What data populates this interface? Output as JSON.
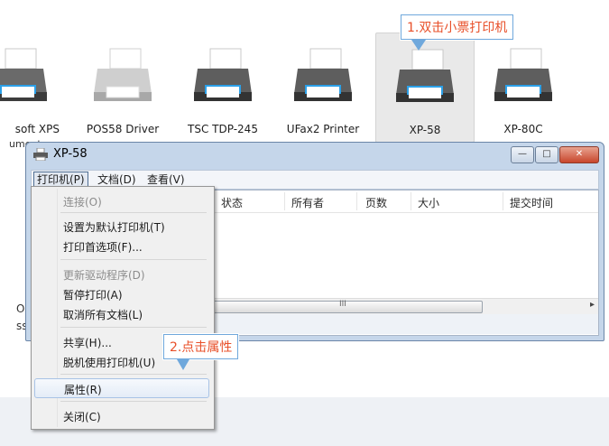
{
  "devices": [
    {
      "label": "soft XPS",
      "selected": false
    },
    {
      "label": "POS58 Driver",
      "selected": false
    },
    {
      "label": "TSC TDP-245",
      "selected": false
    },
    {
      "label": "UFax2 Printer",
      "selected": false
    },
    {
      "label": "XP-58",
      "selected": true
    },
    {
      "label": "XP-80C",
      "selected": false
    }
  ],
  "partial_texts": {
    "line1": "ument",
    "line2": "'ri",
    "left_o": "O",
    "left_ss": "ss"
  },
  "callout1": "1.双击小票打印机",
  "callout2": "2.点击属性",
  "window": {
    "title": "XP-58",
    "min_glyph": "—",
    "max_glyph": "□",
    "close_glyph": "✕",
    "menus": [
      "打印机(P)",
      "文档(D)",
      "查看(V)"
    ],
    "columns": [
      "状态",
      "所有者",
      "页数",
      "大小",
      "提交时间"
    ],
    "scroll_grip": "III",
    "scroll_right": "▸"
  },
  "dropdown": {
    "items": [
      {
        "label": "连接(O)",
        "disabled": true
      },
      {
        "label": "设置为默认打印机(T)",
        "disabled": false
      },
      {
        "label": "打印首选项(F)...",
        "disabled": false
      },
      {
        "label": "更新驱动程序(D)",
        "disabled": true
      },
      {
        "label": "暂停打印(A)",
        "disabled": false
      },
      {
        "label": "取消所有文档(L)",
        "disabled": false
      },
      {
        "label": "共享(H)...",
        "disabled": false
      },
      {
        "label": "脱机使用打印机(U)",
        "disabled": false
      },
      {
        "label": "属性(R)",
        "disabled": false,
        "highlighted": true
      },
      {
        "label": "关闭(C)",
        "disabled": false
      }
    ]
  },
  "colors": {
    "callout_text": "#e8502a",
    "callout_border": "#6fa8dc",
    "window_frame": "#c5d6ea"
  }
}
